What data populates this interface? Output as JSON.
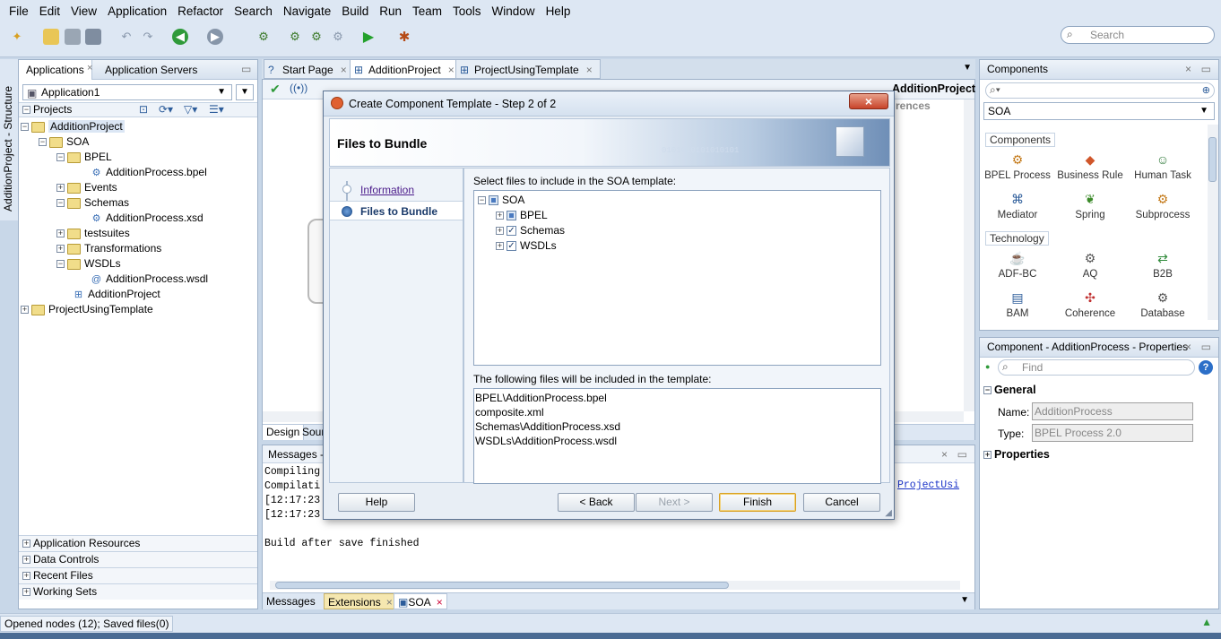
{
  "menu": [
    "File",
    "Edit",
    "View",
    "Application",
    "Refactor",
    "Search",
    "Navigate",
    "Build",
    "Run",
    "Team",
    "Tools",
    "Window",
    "Help"
  ],
  "search": {
    "placeholder": "Search"
  },
  "left": {
    "tabs": [
      "Applications",
      "Application Servers"
    ],
    "app_select": "Application1",
    "projects_label": "Projects",
    "vertical_tab": "AdditionProject - Structure",
    "tree": [
      "AdditionProject",
      "SOA",
      "BPEL",
      "AdditionProcess.bpel",
      "Events",
      "Schemas",
      "AdditionProcess.xsd",
      "testsuites",
      "Transformations",
      "WSDLs",
      "AdditionProcess.wsdl",
      "AdditionProject",
      "ProjectUsingTemplate"
    ],
    "accordion": [
      "Application Resources",
      "Data Controls",
      "Recent Files",
      "Working Sets"
    ]
  },
  "editor": {
    "tabs": [
      "Start Page",
      "AdditionProject",
      "ProjectUsingTemplate"
    ],
    "title": "AdditionProject",
    "bg_text": "rences",
    "bottom_tabs": [
      "Design",
      "Sour"
    ]
  },
  "messages": {
    "title": "Messages -",
    "lines": [
      "Compiling",
      "Compilati",
      "[12:17:23",
      "[12:17:23",
      "",
      "Build after save finished"
    ],
    "link": "ProjectUsi",
    "bottom_tabs": [
      "Messages",
      "Extensions",
      "SOA"
    ]
  },
  "components": {
    "title": "Components",
    "category": "SOA",
    "group1": "Components",
    "items1": [
      "BPEL Process",
      "Business Rule",
      "Human Task",
      "Mediator",
      "Spring",
      "Subprocess"
    ],
    "group2": "Technology",
    "items2": [
      "ADF-BC",
      "AQ",
      "B2B",
      "BAM",
      "Coherence",
      "Database"
    ]
  },
  "properties": {
    "title": "Component - AdditionProcess - Properties",
    "find_placeholder": "Find",
    "general": "General",
    "name_label": "Name:",
    "name_value": "AdditionProcess",
    "type_label": "Type:",
    "type_value": "BPEL Process 2.0",
    "properties_section": "Properties"
  },
  "dialog": {
    "title": "Create Component Template - Step 2 of 2",
    "banner": "Files to Bundle",
    "steps": [
      "Information",
      "Files to Bundle"
    ],
    "select_label": "Select files to include in the SOA template:",
    "tree": [
      "SOA",
      "BPEL",
      "Schemas",
      "WSDLs"
    ],
    "files_label": "The following files will be included in the template:",
    "files": [
      "BPEL\\AdditionProcess.bpel",
      "composite.xml",
      "Schemas\\AdditionProcess.xsd",
      "WSDLs\\AdditionProcess.wsdl"
    ],
    "help": "Help",
    "back": "< Back",
    "next": "Next >",
    "finish": "Finish",
    "cancel": "Cancel"
  },
  "status": "Opened nodes (12); Saved files(0)"
}
